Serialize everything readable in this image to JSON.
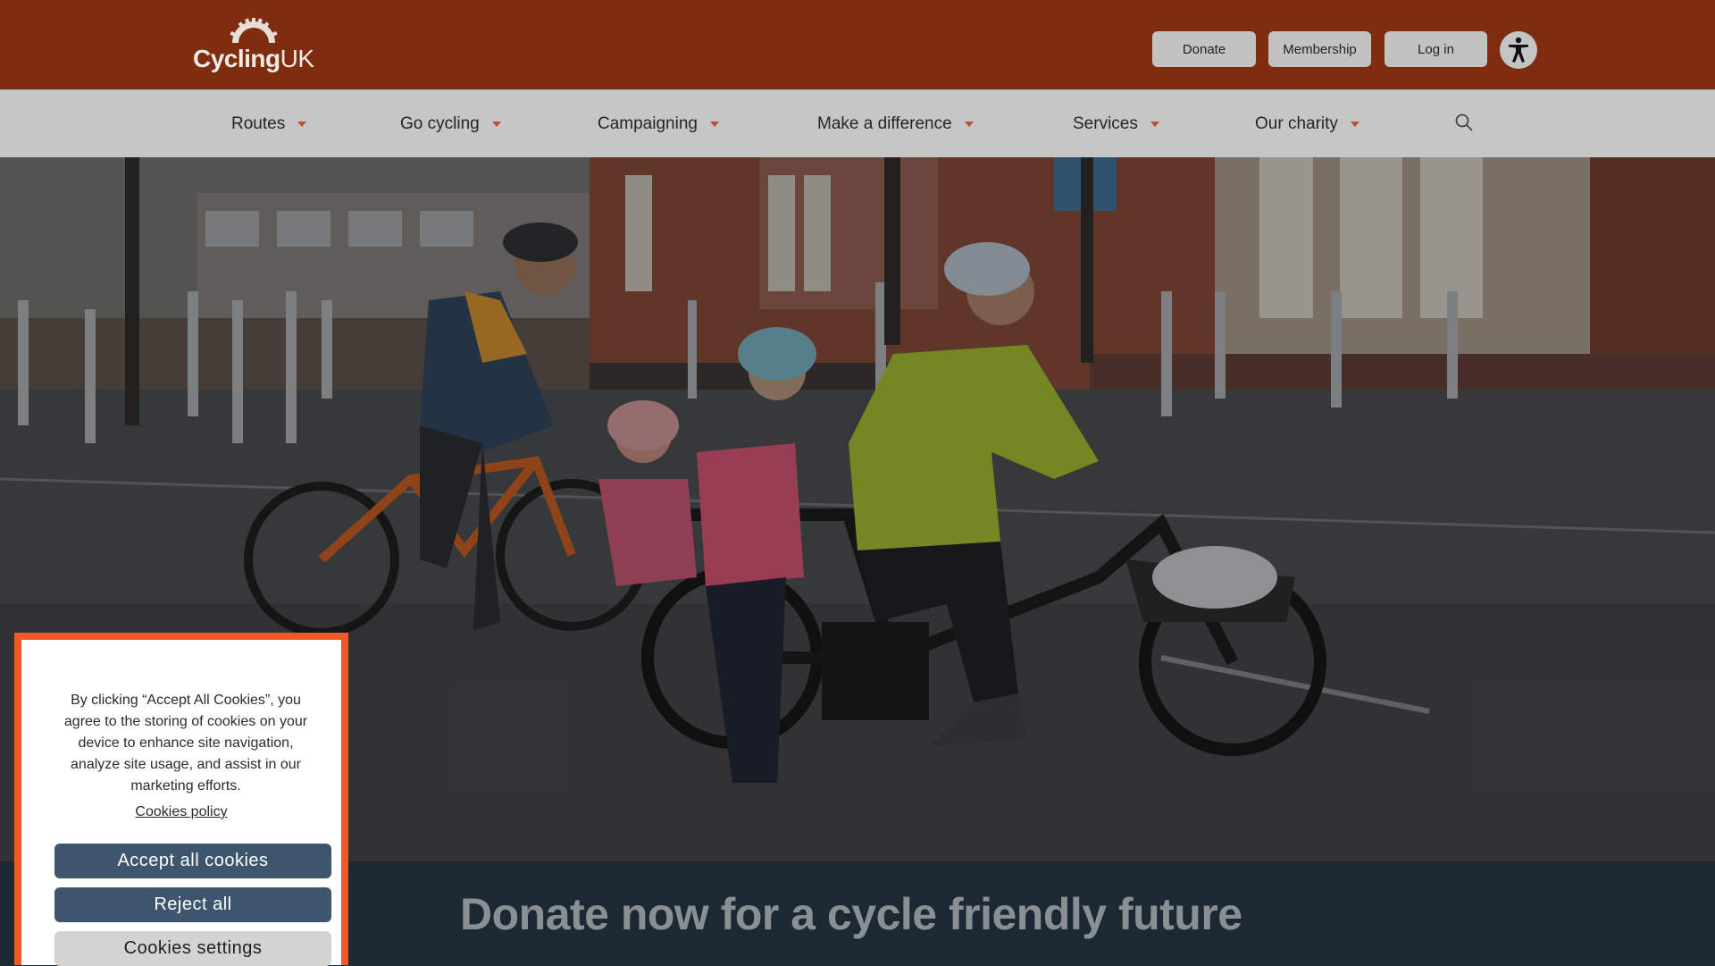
{
  "header": {
    "logo": {
      "brand": "Cycling",
      "brand_suffix": "UK"
    },
    "buttons": {
      "donate": "Donate",
      "membership": "Membership",
      "login": "Log in"
    },
    "accessibility_icon": "accessibility-person-icon"
  },
  "nav": {
    "items": [
      {
        "label": "Routes"
      },
      {
        "label": "Go cycling"
      },
      {
        "label": "Campaigning"
      },
      {
        "label": "Make a difference"
      },
      {
        "label": "Services"
      },
      {
        "label": "Our charity"
      }
    ],
    "search_icon": "search-icon"
  },
  "hero": {
    "image_subject": "family riding bicycles and a cargo e-bike on a city street"
  },
  "donate_band": {
    "heading": "Donate now for a cycle friendly future"
  },
  "cookie_banner": {
    "text": "By clicking “Accept All Cookies”, you agree to the storing of cookies on your device to enhance site navigation, analyze site usage, and assist in our marketing efforts.",
    "policy_link": "Cookies policy",
    "accept_label": "Accept all cookies",
    "reject_label": "Reject all",
    "settings_label": "Cookies settings"
  },
  "colors": {
    "header_bg": "#7e2e0f",
    "nav_bg": "#c6c6c6",
    "accent_orange": "#f15a22",
    "cookie_button": "#3d566e",
    "band_bg": "#1c2934"
  }
}
